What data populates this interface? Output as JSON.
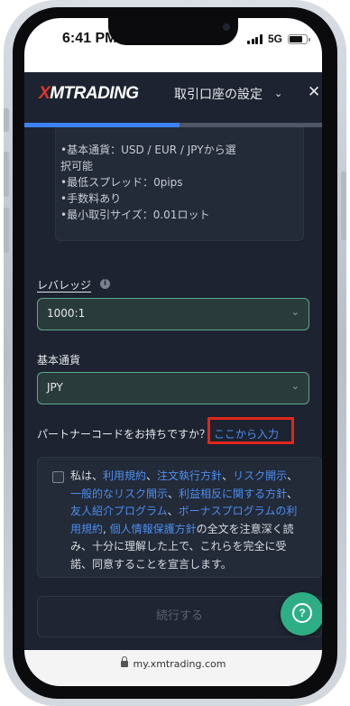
{
  "status_bar": {
    "time": "6:41 PM",
    "network": "5G",
    "battery_level_percent": 85
  },
  "header": {
    "logo_x": "X",
    "logo_rest": "MTRADING",
    "title": "取引口座の設定",
    "chevron_glyph": "⌄",
    "close_glyph": "✕"
  },
  "progress": {
    "value_fraction": 0.52
  },
  "account_info": {
    "lines": [
      "•基本通貨：USD / EUR / JPYから選",
      "択可能",
      "•最低スプレッド：0pips",
      "•手数料あり",
      "•最小取引サイズ：0.01ロット"
    ]
  },
  "leverage": {
    "label": "レバレッジ",
    "info_glyph": "i",
    "value": "1000:1",
    "chevron_glyph": "⌄"
  },
  "base_currency": {
    "label": "基本通貨",
    "value": "JPY",
    "chevron_glyph": "⌄"
  },
  "partner": {
    "question": "パートナーコードをお持ちですか？",
    "link": "ここから入力"
  },
  "agreement": {
    "prefix": "私は、",
    "link1": "利用規約",
    "sep1": "、",
    "link2": "注文執行方針",
    "sep2": "、",
    "link3": "リスク開示",
    "sep3": "、",
    "link4": "一般的なリスク開示",
    "sep4": "、",
    "link5": "利益相反に関する方針",
    "sep5": "、",
    "link6": "友人紹介プログラム",
    "sep6": "、",
    "link7": "ボーナスプログラムの利用規約",
    "sep7": ", ",
    "link8": "個人情報保護方針",
    "suffix": "の全文を注意深く読み、十分に理解した上で、これらを完全に受諾、同意することを宣言します。"
  },
  "continue_button": {
    "label": "続行する"
  },
  "help_button": {
    "glyph": "?"
  },
  "address_bar": {
    "url": "my.xmtrading.com"
  },
  "colors": {
    "background": "#1d2330",
    "accent_blue": "#3c82f6",
    "link": "#4a8ff0",
    "select_border": "#5fa889",
    "help_green": "#2eae84",
    "highlight_red": "#e0261b"
  }
}
